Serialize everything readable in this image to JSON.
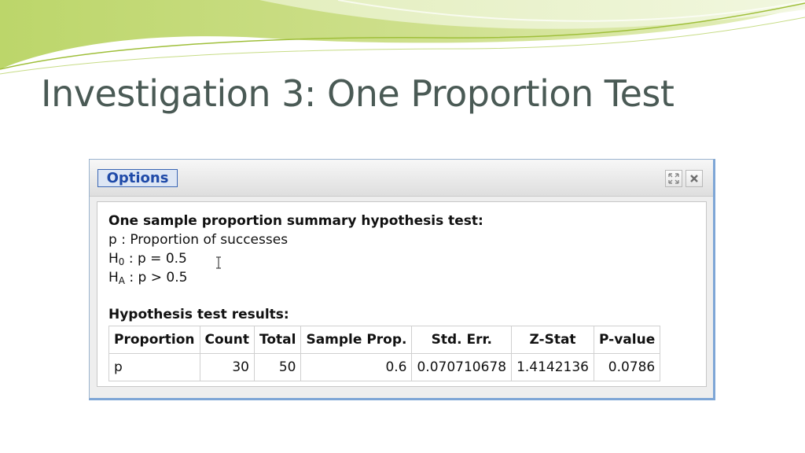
{
  "slide": {
    "title": "Investigation 3: One Proportion Test"
  },
  "window": {
    "options_label": "Options",
    "controls": {
      "expand_icon": "expand-icon",
      "close_icon": "close-icon"
    }
  },
  "output": {
    "heading": "One sample proportion summary hypothesis test:",
    "param_line": "p : Proportion of successes",
    "h0": {
      "symbol": "H",
      "sub": "0",
      "text": " : p = 0.5"
    },
    "ha": {
      "symbol": "H",
      "sub": "A",
      "text": " : p > 0.5"
    },
    "results_heading": "Hypothesis test results:",
    "table": {
      "headers": [
        "Proportion",
        "Count",
        "Total",
        "Sample Prop.",
        "Std. Err.",
        "Z-Stat",
        "P-value"
      ],
      "rows": [
        [
          "p",
          "30",
          "50",
          "0.6",
          "0.070710678",
          "1.4142136",
          "0.0786"
        ]
      ]
    }
  },
  "colors": {
    "title": "#4a5a55",
    "options_text": "#1f4aa8",
    "window_border": "#7ea6d6",
    "swoosh_green": "#a9c94a"
  }
}
